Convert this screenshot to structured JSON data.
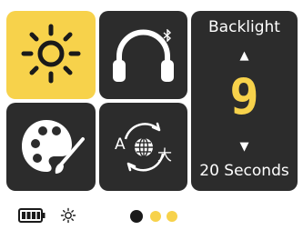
{
  "tiles": {
    "brightness": {
      "icon": "sun-icon",
      "active": true
    },
    "bluetooth_audio": {
      "icon": "headphones-icon",
      "badge_icon": "bluetooth-icon"
    },
    "theme": {
      "icon": "palette-icon"
    },
    "language": {
      "icon": "language-icon",
      "glyph_a": "A",
      "glyph_b": "大"
    }
  },
  "backlight": {
    "title": "Backlight",
    "up_arrow": "▲",
    "value": "9",
    "down_arrow": "▼",
    "duration": "20 Seconds"
  },
  "status": {
    "battery_icon": "battery-full-icon",
    "brightness_icon": "sun-small-icon"
  },
  "pager": {
    "pages": 3,
    "current": 1
  },
  "colors": {
    "accent": "#f7d24b",
    "tile_dark": "#2c2c2c",
    "text_light": "#ffffff"
  }
}
